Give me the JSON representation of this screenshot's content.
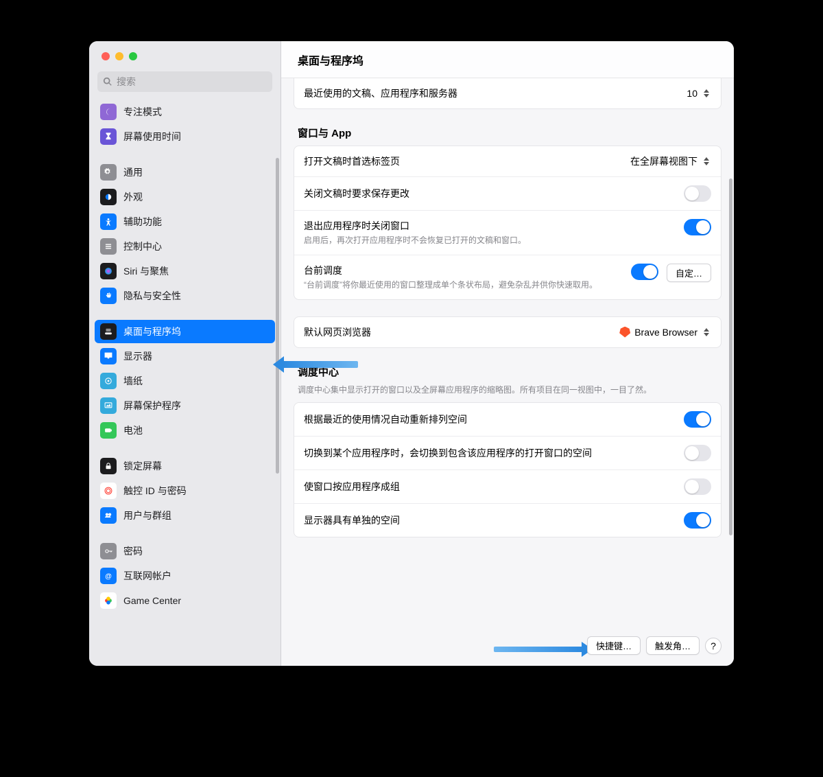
{
  "search_placeholder": "搜索",
  "header_title": "桌面与程序坞",
  "sidebar": {
    "items": [
      {
        "label": "专注模式",
        "icon_bg": "#8f68d5",
        "icon": "moon",
        "name": "sidebar-item-focus"
      },
      {
        "label": "屏幕使用时间",
        "icon_bg": "#6a55d7",
        "icon": "hourglass",
        "name": "sidebar-item-screentime"
      },
      {
        "sep": true
      },
      {
        "label": "通用",
        "icon_bg": "#8e8e93",
        "icon": "gear",
        "name": "sidebar-item-general"
      },
      {
        "label": "外观",
        "icon_bg": "#1c1c1e",
        "icon": "appearance",
        "name": "sidebar-item-appearance"
      },
      {
        "label": "辅助功能",
        "icon_bg": "#0a7aff",
        "icon": "accessibility",
        "name": "sidebar-item-accessibility"
      },
      {
        "label": "控制中心",
        "icon_bg": "#8e8e93",
        "icon": "sliders",
        "name": "sidebar-item-control-center"
      },
      {
        "label": "Siri 与聚焦",
        "icon_bg": "#1c1c1e",
        "icon": "siri",
        "name": "sidebar-item-siri-spotlight"
      },
      {
        "label": "隐私与安全性",
        "icon_bg": "#0a7aff",
        "icon": "hand",
        "name": "sidebar-item-privacy"
      },
      {
        "sep": true
      },
      {
        "label": "桌面与程序坞",
        "icon_bg": "#1c1c1e",
        "icon": "dock",
        "name": "sidebar-item-desktop-dock",
        "selected": true
      },
      {
        "label": "显示器",
        "icon_bg": "#0a7aff",
        "icon": "display",
        "name": "sidebar-item-displays"
      },
      {
        "label": "墙纸",
        "icon_bg": "#34aadc",
        "icon": "wallpaper",
        "name": "sidebar-item-wallpaper"
      },
      {
        "label": "屏幕保护程序",
        "icon_bg": "#34aadc",
        "icon": "screensaver",
        "name": "sidebar-item-screensaver"
      },
      {
        "label": "电池",
        "icon_bg": "#34c759",
        "icon": "battery",
        "name": "sidebar-item-battery"
      },
      {
        "sep": true
      },
      {
        "label": "锁定屏幕",
        "icon_bg": "#1c1c1e",
        "icon": "lock",
        "name": "sidebar-item-lock-screen"
      },
      {
        "label": "触控 ID 与密码",
        "icon_bg": "#ffffff",
        "icon": "touchid",
        "name": "sidebar-item-touchid"
      },
      {
        "label": "用户与群组",
        "icon_bg": "#0a7aff",
        "icon": "users",
        "name": "sidebar-item-users-groups"
      },
      {
        "sep": true
      },
      {
        "label": "密码",
        "icon_bg": "#8e8e93",
        "icon": "key",
        "name": "sidebar-item-passwords"
      },
      {
        "label": "互联网帐户",
        "icon_bg": "#0a7aff",
        "icon": "at",
        "name": "sidebar-item-internet-accounts"
      },
      {
        "label": "Game Center",
        "icon_bg": "#ffffff",
        "icon": "gamecenter",
        "name": "sidebar-item-game-center"
      }
    ]
  },
  "truncated_row": {
    "label": "最近使用的文稿、应用程序和服务器",
    "value": "10"
  },
  "sections": {
    "windows": {
      "title": "窗口与 App",
      "rows": {
        "prefer_tabs": {
          "label": "打开文稿时首选标签页",
          "value": "在全屏幕视图下"
        },
        "ask_save": {
          "label": "关闭文稿时要求保存更改",
          "on": false
        },
        "close_windows": {
          "label": "退出应用程序时关闭窗口",
          "sub": "启用后，再次打开应用程序时不会恢复已打开的文稿和窗口。",
          "on": true
        },
        "stage_manager": {
          "label": "台前调度",
          "sub": "“台前调度”将你最近使用的窗口整理成单个条状布局，避免杂乱并供你快速取用。",
          "on": true,
          "btn": "自定…"
        }
      }
    },
    "browser": {
      "label": "默认网页浏览器",
      "value": "Brave Browser"
    },
    "mission_control": {
      "title": "调度中心",
      "sub": "调度中心集中显示打开的窗口以及全屏幕应用程序的缩略图。所有项目在同一视图中，一目了然。",
      "rows": {
        "auto_rearrange": {
          "label": "根据最近的使用情况自动重新排列空间",
          "on": true
        },
        "switch_space": {
          "label": "切换到某个应用程序时，会切换到包含该应用程序的打开窗口的空间",
          "on": false
        },
        "group_by_app": {
          "label": "使窗口按应用程序成组",
          "on": false
        },
        "separate_spaces": {
          "label": "显示器具有单独的空间",
          "on": true
        }
      }
    }
  },
  "footer": {
    "shortcuts": "快捷键…",
    "hot_corners": "触发角…",
    "help": "?"
  }
}
